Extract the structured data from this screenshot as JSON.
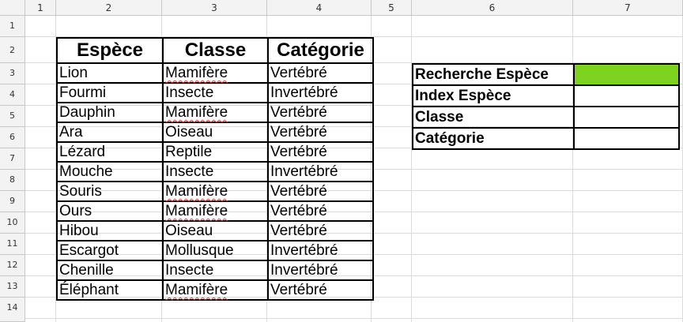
{
  "column_headers": [
    "1",
    "2",
    "3",
    "4",
    "5",
    "6",
    "7"
  ],
  "row_headers": [
    "1",
    "2",
    "3",
    "4",
    "5",
    "6",
    "7",
    "8",
    "9",
    "10",
    "11",
    "12",
    "13",
    "14"
  ],
  "species_table": {
    "headers": [
      "Espèce",
      "Classe",
      "Catégorie"
    ],
    "rows": [
      [
        "Lion",
        "Mamifère",
        "Vertébré"
      ],
      [
        "Fourmi",
        "Insecte",
        "Invertébré"
      ],
      [
        "Dauphin",
        "Mamifère",
        "Vertébré"
      ],
      [
        "Ara",
        "Oiseau",
        "Vertébré"
      ],
      [
        "Lézard",
        "Reptile",
        "Vertébré"
      ],
      [
        "Mouche",
        "Insecte",
        "Invertébré"
      ],
      [
        "Souris",
        "Mamifère",
        "Vertébré"
      ],
      [
        "Ours",
        "Mamifère",
        "Vertébré"
      ],
      [
        "Hibou",
        "Oiseau",
        "Vertébré"
      ],
      [
        "Escargot",
        "Mollusque",
        "Invertébré"
      ],
      [
        "Chenille",
        "Insecte",
        "Invertébré"
      ],
      [
        "Éléphant",
        "Mamifère",
        "Vertébré"
      ]
    ]
  },
  "lookup_table": {
    "labels": [
      "Recherche Espèce",
      "Index Espèce",
      "Classe",
      "Catégorie"
    ],
    "values": [
      "",
      "",
      "",
      ""
    ],
    "highlight_color": "#7ed321"
  }
}
